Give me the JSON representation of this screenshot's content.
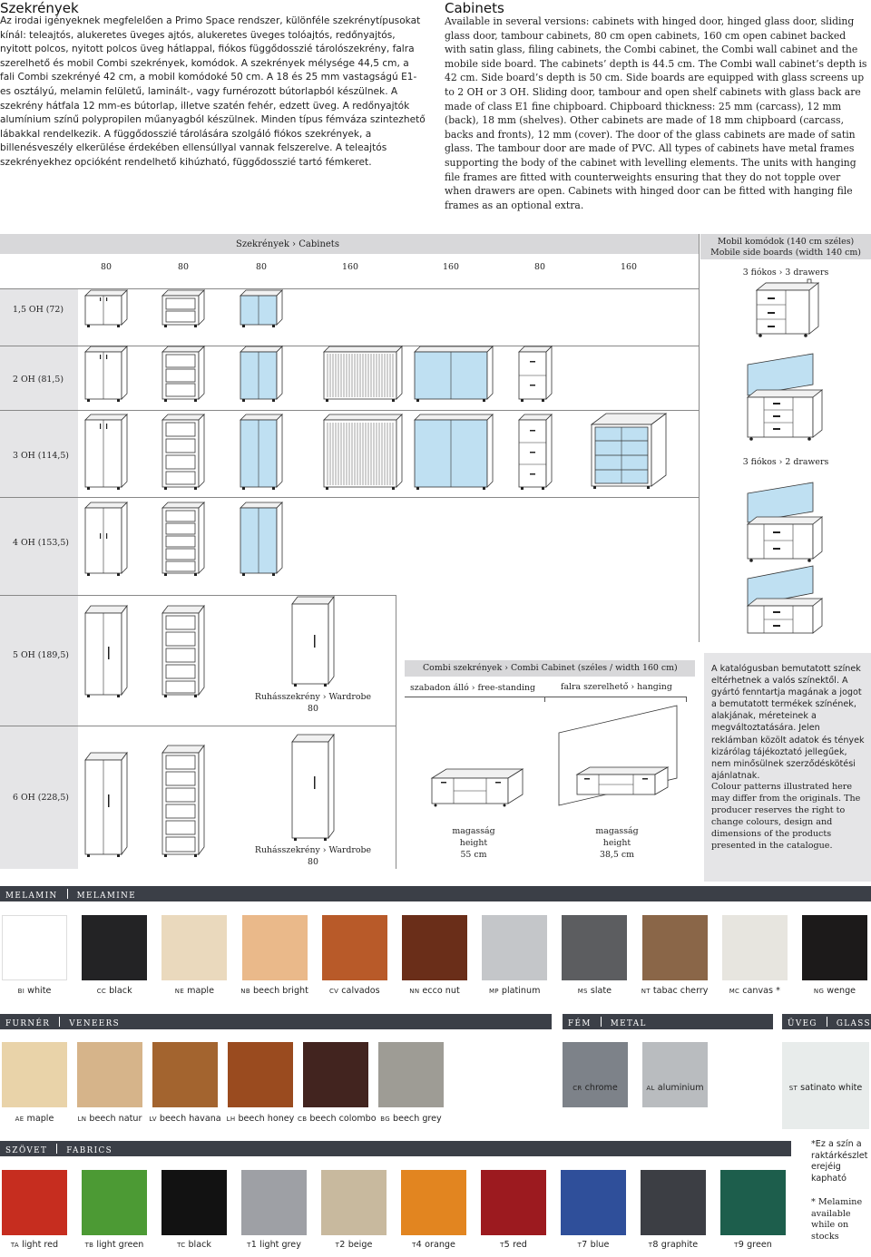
{
  "hu": {
    "title": "Szekrények",
    "body": "Az irodai igényeknek megfelelően a Primo Space rendszer, különféle szekrénytípusokat kínál: teleajtós, alukeretes üveges ajtós, alukeretes üveges tolóajtós, redőnyajtós, nyitott polcos, nyitott polcos üveg hátlappal, fiókos függődosszié tárolószekrény, falra szerelhető és mobil Combi szekrények, komódok. A szekrények mélysége 44,5 cm, a fali Combi szekrényé 42 cm, a mobil komódoké 50 cm. A 18 és 25 mm vastagságú E1-es osztályú, melamin felületű, laminált-, vagy furnérozott bútorlapból készülnek. A szekrény hátfala 12 mm-es bútorlap, illetve szatén fehér, edzett üveg. A redőnyajtók alumínium színű polypropilen műanyagból készülnek. Minden típus fémváza szintezhető lábakkal rendelkezik. A függődosszié tárolására szolgáló fiókos szekrények, a billenésveszély elkerülése érdekében ellensúllyal vannak felszerelve. A teleajtós szekrényekhez opcióként rendelhető kihúzható, függődosszié tartó fémkeret."
  },
  "en": {
    "title": "Cabinets",
    "body": "Available in several versions: cabinets with hinged door, hinged glass door, sliding glass door, tambour cabinets, 80 cm open cabinets, 160 cm open cabinet backed with satin glass, filing cabinets, the Combi cabinet, the Combi wall cabinet and the mobile side board. The cabinets’ depth is 44.5 cm. The Combi wall cabinet’s depth is 42 cm. Side board’s depth is 50 cm. Side boards are equipped with glass screens up to 2 OH or 3 OH. Sliding door, tambour and open shelf cabinets with glass back are made of class E1 fine chipboard. Chipboard thickness: 25 mm (carcass), 12 mm (back), 18 mm (shelves). Other cabinets are made of 18 mm chipboard (carcass, backs and fronts), 12 mm (cover). The door of the glass cabinets are made of satin glass. The tambour door are made of PVC. All types of cabinets have metal frames supporting the body of the cabinet with levelling elements. The units with hanging file frames are fitted with counterweights ensuring that they do not topple over when drawers are open. Cabinets with hinged door can be fitted with hanging file frames as an optional extra."
  },
  "table": {
    "header": "Szekrények  ›  Cabinets",
    "widths": [
      "80",
      "80",
      "80",
      "160",
      "160",
      "80",
      "160"
    ],
    "rows": [
      "1,5 OH (72)",
      "2 OH (81,5)",
      "3 OH (114,5)",
      "4 OH (153,5)",
      "5 OH (189,5)",
      "6 OH (228,5)"
    ],
    "wardrobe1_name": "Ruhásszekrény  ›  Wardrobe",
    "wardrobe1_width": "80",
    "wardrobe2_name": "Ruhásszekrény  ›  Wardrobe",
    "wardrobe2_width": "80"
  },
  "mobile": {
    "title_hu": "Mobil komódok (140 cm széles)",
    "title_en": "Mobile side boards (width 140 cm)",
    "drawers3": "3 fiókos  ›  3 drawers",
    "drawers2": "3 fiókos  ›  2 drawers"
  },
  "combi": {
    "header": "Combi szekrények  ›  Combi Cabinet (széles / width 160 cm)",
    "free": "szabadon álló  ›  free-standing",
    "hanging": "falra szerelhető  ›  hanging",
    "free_h1": "magasság",
    "free_h2": "height",
    "free_h3": "55 cm",
    "hang_h1": "magasság",
    "hang_h2": "height",
    "hang_h3": "38,5 cm"
  },
  "disclaimer": {
    "hu": "A katalógusban bemutatott színek eltérhetnek a valós színektől. A gyártó fenntartja magának a jogot a bemutatott termékek színének, alakjának, méreteinek a megváltoztatására. Jelen reklámban közölt adatok és tények kizárólag tájékoztató jellegűek, nem minősülnek szerződéskötési ajánlatnak.",
    "en": "Colour patterns illustrated here may differ from the originals. The producer reserves the right to change colours, design and dimensions of the products presented in the catalogue."
  },
  "melamine": {
    "hu": "MELAMIN",
    "en": "MELAMINE",
    "items": [
      {
        "code": "BI",
        "name": "white",
        "color": "#ffffff"
      },
      {
        "code": "CC",
        "name": "black",
        "color": "#232325"
      },
      {
        "code": "NE",
        "name": "maple",
        "color": "#ead9bd"
      },
      {
        "code": "NB",
        "name": "beech bright",
        "color": "#eab98a"
      },
      {
        "code": "CV",
        "name": "calvados",
        "color": "#b85a29"
      },
      {
        "code": "NN",
        "name": "ecco nut",
        "color": "#6a2e19"
      },
      {
        "code": "MP",
        "name": "platinum",
        "color": "#c4c6c9"
      },
      {
        "code": "MS",
        "name": "slate",
        "color": "#5c5d60"
      },
      {
        "code": "NT",
        "name": "tabac cherry",
        "color": "#8a6648"
      },
      {
        "code": "MC",
        "name": "canvas *",
        "color": "#e7e5df"
      },
      {
        "code": "NG",
        "name": "wenge",
        "color": "#1c1a1a"
      }
    ]
  },
  "veneers": {
    "hu": "FURNÉR",
    "en": "VENEERS",
    "items": [
      {
        "code": "AE",
        "name": "maple",
        "color": "#e9d3a9"
      },
      {
        "code": "LN",
        "name": "beech natur",
        "color": "#d6b48a"
      },
      {
        "code": "LV",
        "name": "beech havana",
        "color": "#a3642f"
      },
      {
        "code": "LH",
        "name": "beech honey",
        "color": "#9a4b1f"
      },
      {
        "code": "CB",
        "name": "beech colombo",
        "color": "#42241f"
      },
      {
        "code": "BG",
        "name": "beech grey",
        "color": "#9e9c95"
      }
    ]
  },
  "metal": {
    "hu": "FÉM",
    "en": "METAL",
    "items": [
      {
        "code": "CR",
        "name": "chrome",
        "color": "#7d8289"
      },
      {
        "code": "AL",
        "name": "aluminium",
        "color": "#b9bcbf"
      }
    ]
  },
  "glass": {
    "hu": "ÜVEG",
    "en": "GLASS",
    "items": [
      {
        "code": "ST",
        "name": "satinato white",
        "color": "#e8eceb"
      }
    ]
  },
  "fabrics": {
    "hu": "SZÖVET",
    "en": "FABRICS",
    "items": [
      {
        "code": "TA",
        "name": "light red",
        "color": "#c62d1f"
      },
      {
        "code": "TB",
        "name": "light green",
        "color": "#4c9a34"
      },
      {
        "code": "TC",
        "name": "black",
        "color": "#121212"
      },
      {
        "code": "T1",
        "name": "light grey",
        "color": "#9ea0a5"
      },
      {
        "code": "T2",
        "name": "beige",
        "color": "#c8b99e"
      },
      {
        "code": "T4",
        "name": "orange",
        "color": "#e28520"
      },
      {
        "code": "T5",
        "name": "red",
        "color": "#9c1a1f"
      },
      {
        "code": "T7",
        "name": "blue",
        "color": "#2f4f9a"
      },
      {
        "code": "T8",
        "name": "graphite",
        "color": "#3c3e44"
      },
      {
        "code": "T9",
        "name": "green",
        "color": "#1d5e4c"
      }
    ]
  },
  "footnote": {
    "hu": "*Ez a szín a raktárkészlet erejéig kapható",
    "en": "* Melamine available while on stocks"
  }
}
